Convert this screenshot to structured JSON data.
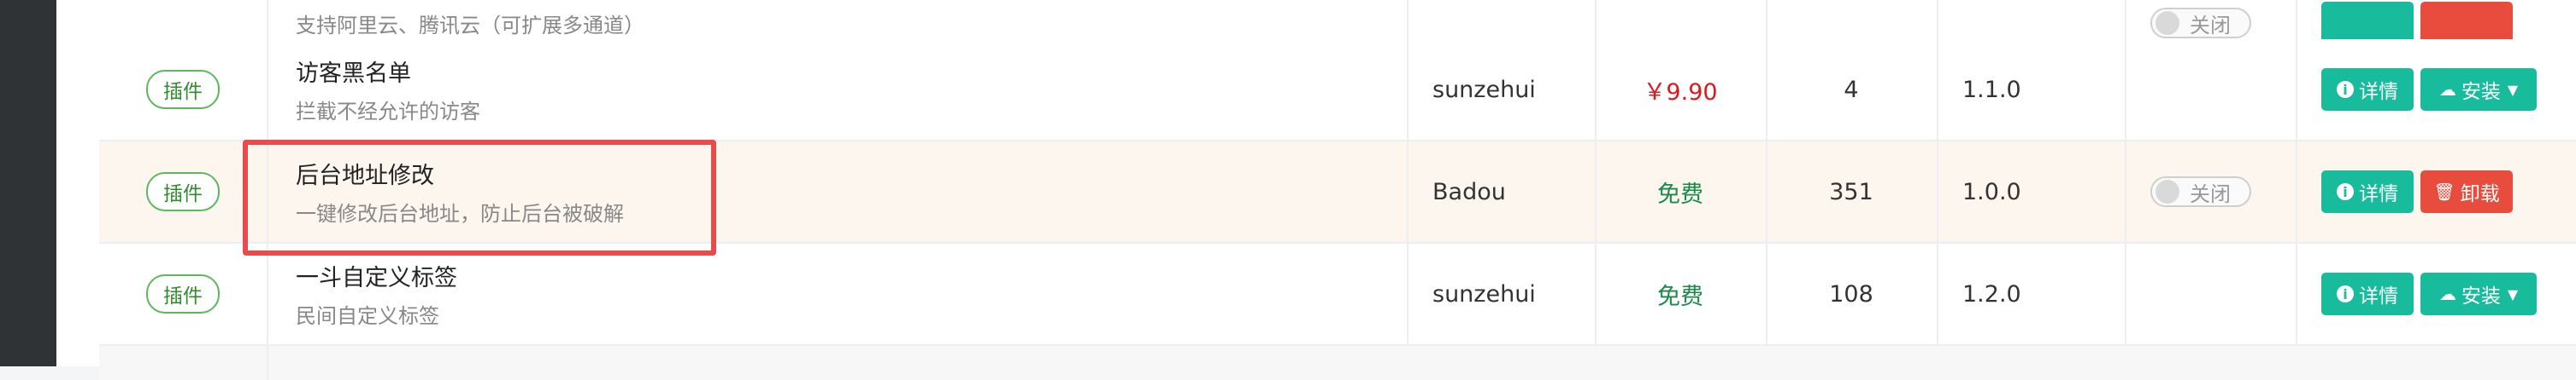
{
  "top_partial": {
    "desc": "支持阿里云、腾讯云（可扩展多通道）",
    "toggle_label": "关闭"
  },
  "rows": [
    {
      "type": "插件",
      "title": "访客黑名单",
      "desc": "拦截不经允许的访客",
      "author": "sunzehui",
      "price": "￥9.90",
      "downloads": "4",
      "version": "1.1.0",
      "detail_label": "详情",
      "action_label": "安装"
    },
    {
      "type": "插件",
      "title": "后台地址修改",
      "desc": "一键修改后台地址，防止后台被破解",
      "author": "Badou",
      "price": "免费",
      "downloads": "351",
      "version": "1.0.0",
      "toggle_label": "关闭",
      "detail_label": "详情",
      "action_label": "卸载"
    },
    {
      "type": "插件",
      "title": "一斗自定义标签",
      "desc": "民间自定义标签",
      "author": "sunzehui",
      "price": "免费",
      "downloads": "108",
      "version": "1.2.0",
      "detail_label": "详情",
      "action_label": "安装"
    }
  ],
  "colors": {
    "accent": "#18bc9c",
    "danger": "#e74c3c",
    "price_paid": "#e0181c",
    "price_free": "#1a8a4a",
    "highlight": "#e84b4b"
  }
}
